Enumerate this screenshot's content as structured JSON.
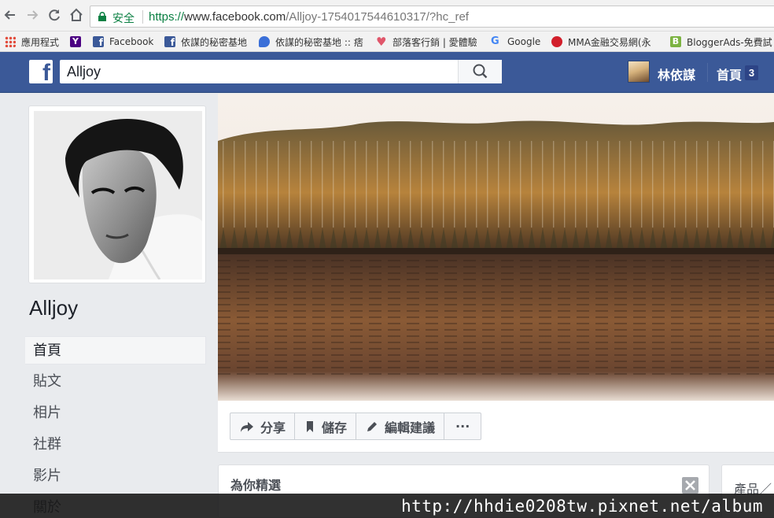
{
  "browser": {
    "secure_label": "安全",
    "url_protocol": "https://",
    "url_host": "www.facebook.com",
    "url_path": "/Alljoy-1754017544610317/?hc_ref",
    "bookmarks": [
      {
        "label": "應用程式",
        "icon": "apps-grid-icon",
        "color": "#e24b3b"
      },
      {
        "label": "",
        "icon": "yahoo-icon",
        "color": "#4b0082"
      },
      {
        "label": "Facebook",
        "icon": "facebook-icon",
        "color": "#3b5998"
      },
      {
        "label": "依謀的秘密基地",
        "icon": "facebook-icon",
        "color": "#3b5998"
      },
      {
        "label": "依謀的秘密基地 :: 痞",
        "icon": "pixnet-icon",
        "color": "#3a6fd8"
      },
      {
        "label": "部落客行銷 | 愛體驗",
        "icon": "heart-icon",
        "color": "#e0566b"
      },
      {
        "label": "Google",
        "icon": "google-icon",
        "color": "#4285f4"
      },
      {
        "label": "MMA金融交易網(永",
        "icon": "mma-icon",
        "color": "#d21f2b"
      },
      {
        "label": "BloggerAds-免費試",
        "icon": "bloggerads-icon",
        "color": "#7cb342"
      }
    ]
  },
  "fb": {
    "logo": "f",
    "search_value": "Alljoy",
    "user_name": "林依謀",
    "home_label": "首頁",
    "home_count": "3"
  },
  "page": {
    "name": "Alljoy",
    "nav": [
      "首頁",
      "貼文",
      "相片",
      "社群",
      "影片",
      "關於"
    ],
    "actions": [
      "分享",
      "儲存",
      "編輯建議"
    ],
    "more": "···",
    "card_title": "為你精選",
    "card_right_title": "產品／"
  },
  "watermark": "http://hhdie0208tw.pixnet.net/album"
}
